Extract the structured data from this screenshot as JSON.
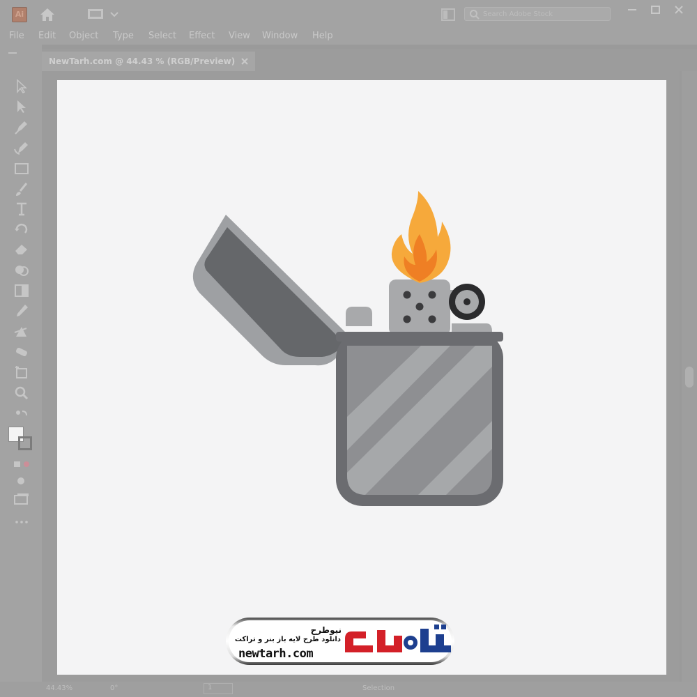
{
  "app": {
    "logo_text": "Ai",
    "search_placeholder": "Search Adobe Stock"
  },
  "menu": [
    "File",
    "Edit",
    "Object",
    "Type",
    "Select",
    "Effect",
    "View",
    "Window",
    "Help"
  ],
  "document_tab": {
    "title": "NewTarh.com @ 44.43 % (RGB/Preview)"
  },
  "tools": [
    "selection-tool",
    "direct-selection-tool",
    "pen-tool",
    "curvature-tool",
    "rectangle-tool",
    "paintbrush-tool",
    "type-tool",
    "rotate-tool",
    "eraser-tool",
    "shape-builder-tool",
    "gradient-tool",
    "eyedropper-tool",
    "blend-tool",
    "symbol-sprayer-tool",
    "artboard-tool",
    "zoom-tool"
  ],
  "status": {
    "zoom": "44.43%",
    "rotation": "0°",
    "page": "1",
    "current_tool": "Selection"
  },
  "artwork": {
    "colors": {
      "case_body": "#8e8f92",
      "case_rim": "#6b6c70",
      "stripe": "#a6a8aa",
      "lid_dark": "#65676a",
      "lid_light": "#9ea0a3",
      "chimney": "#a8a9ab",
      "flame_outer": "#f6a93b",
      "flame_inner": "#ef7f24",
      "wheel": "#2b2b2d"
    }
  },
  "watermark": {
    "fa_title": "نیوطرح",
    "fa_subtitle": "دانلود طرح لایه باز بنر و تراکت",
    "url": "newtarh.com",
    "brand_red": "#d32028",
    "brand_blue": "#1d3f8f"
  }
}
